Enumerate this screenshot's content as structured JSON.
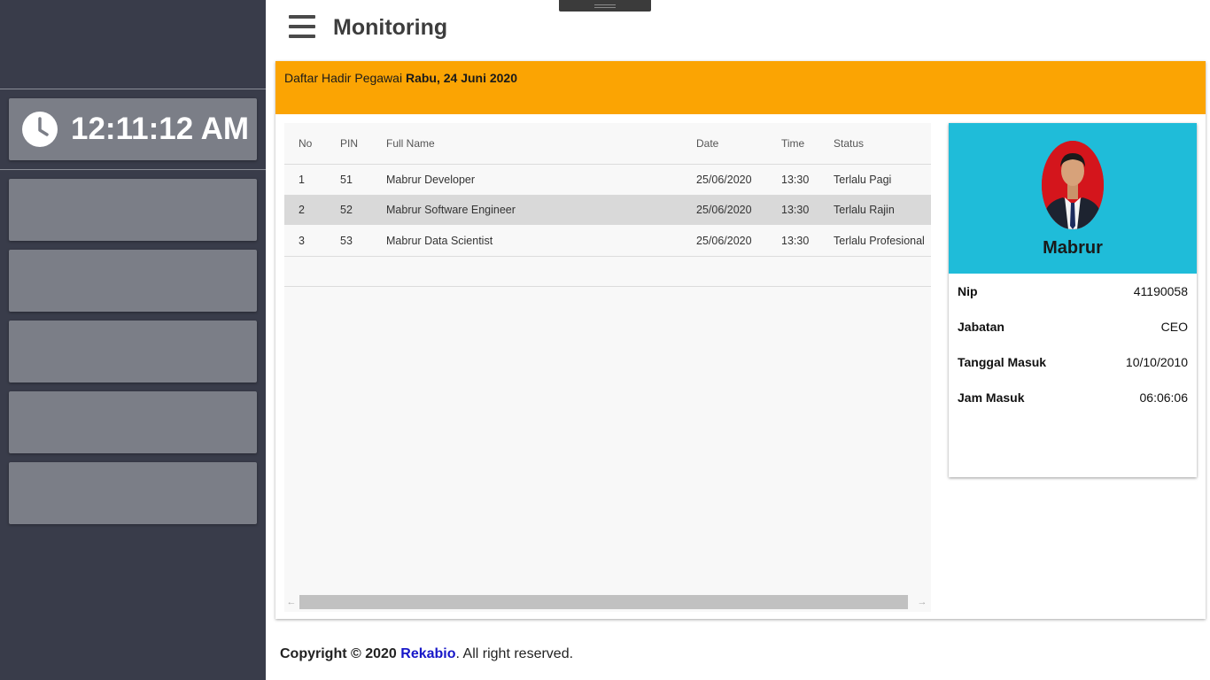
{
  "sidebar": {
    "clock_time": "12:11:12 AM",
    "clock_icon": "clock-icon"
  },
  "header": {
    "menu_icon": "hamburger-menu-icon",
    "title": "Monitoring"
  },
  "attendance": {
    "title_prefix": "Daftar Hadir Pegawai",
    "title_date": "Rabu, 24 Juni 2020",
    "columns": [
      "No",
      "PIN",
      "Full Name",
      "Date",
      "Time",
      "Status"
    ],
    "rows": [
      {
        "no": "1",
        "pin": "51",
        "name": "Mabrur Developer",
        "date": "25/06/2020",
        "time": "13:30",
        "status": "Terlalu Pagi"
      },
      {
        "no": "2",
        "pin": "52",
        "name": "Mabrur Software Engineer",
        "date": "25/06/2020",
        "time": "13:30",
        "status": "Terlalu Rajin"
      },
      {
        "no": "3",
        "pin": "53",
        "name": "Mabrur Data Scientist",
        "date": "25/06/2020",
        "time": "13:30",
        "status": "Terlalu Profesional"
      }
    ],
    "scroll_left_icon": "arrow-left-icon",
    "scroll_right_icon": "arrow-right-icon"
  },
  "profile": {
    "name": "Mabrur",
    "fields": [
      {
        "label": "Nip",
        "value": "41190058"
      },
      {
        "label": "Jabatan",
        "value": "CEO"
      },
      {
        "label": "Tanggal Masuk",
        "value": "10/10/2010"
      },
      {
        "label": "Jam Masuk",
        "value": "06:06:06"
      }
    ]
  },
  "footer": {
    "copyright": "Copyright © 2020",
    "brand": "Rekabio",
    "suffix": ". All right reserved."
  },
  "colors": {
    "sidebar_bg": "#393c4a",
    "card_bg": "#7b7e87",
    "header_accent": "#fba403",
    "profile_accent": "#1fbcd9",
    "link": "#1717c8"
  }
}
